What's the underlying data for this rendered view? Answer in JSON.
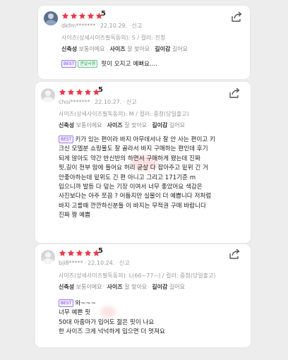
{
  "reviews": [
    {
      "user": "dkfm*******",
      "date": "22.10.29.",
      "report": "신고",
      "rating": "5",
      "stars": 5,
      "option": "사이즈(상세사이즈필독동의): S / 컬러: 진청",
      "attrs": [
        {
          "label": "신축성",
          "value": "보통이에요"
        },
        {
          "label": "사이즈",
          "value": "잘 맞아요"
        },
        {
          "label": "길이감",
          "value": "길어요"
        }
      ],
      "badges": [
        "BEST",
        "한달사용"
      ],
      "text": [
        "핏이 오지고 예뻐요...."
      ]
    },
    {
      "user": "choi*******",
      "date": "22.10.27.",
      "report": "신고",
      "rating": "5",
      "stars": 5,
      "option": "사이즈(상세사이즈필독동의): M / 컬러: 중청(당일출고)",
      "attrs": [
        {
          "label": "신축성",
          "value": "보통이에요"
        },
        {
          "label": "사이즈",
          "value": "잘 맞아요"
        },
        {
          "label": "길이감",
          "value": "길어요"
        }
      ],
      "badges": [
        "BEST"
      ],
      "text": [
        "키가 있는 편이라 바지 아무데서나 잘 안 사는 편이고 키",
        "크신 모델분 쇼핑몰도 잘 골라서 바지 구매하는 편인데 후기",
        "되게 많아도 약간 반신반의 하면서 구매하게 됐는데 진짜",
        "핏,길이 전부 맘에 들어요 허리 굳살 다 잡아주고 밑위 긴 거",
        "안좋아하는데 밑위도 긴 편 아니고 그리고 171기준 m",
        "입으니까 발등 다 덮는 기장 이여서 너무 좋았어요 색감은",
        "사진보다는 아주 쪼끔 ? 어둡지만 실물이 더 예쁩니다 저처럼",
        "바지 고를때 깐깐하신분들 이 바지는 무적권 구매 바랍니다",
        "진짜 짱 예쁨"
      ]
    },
    {
      "user": "bji8*****",
      "date": "22.10.24.",
      "report": "신고",
      "rating": "5",
      "stars": 5,
      "option": "사이즈(상세사이즈필독동의): L(66~77~) / 컬러: 중청(당일출고)",
      "attrs": [
        {
          "label": "신축성",
          "value": "보통이에요"
        },
        {
          "label": "사이즈",
          "value": "잘 맞아요"
        },
        {
          "label": "길이감",
          "value": "길어요"
        }
      ],
      "badges": [
        "BEST"
      ],
      "text": [
        "와~~~",
        "너무  예쁜  핏",
        "50대 아줌마가  입어도  젊은 핏이  나요",
        "한 사이즈  크게  넉넉하게  입으면  더  멋져요"
      ]
    }
  ],
  "colors": {
    "star": "#f0364a",
    "best": "#7b3fe4",
    "month_badge": "#2b9a5b",
    "background": "#ededed"
  },
  "icons": {
    "share": "share-icon",
    "star": "star-icon",
    "avatar": "avatar-icon"
  }
}
